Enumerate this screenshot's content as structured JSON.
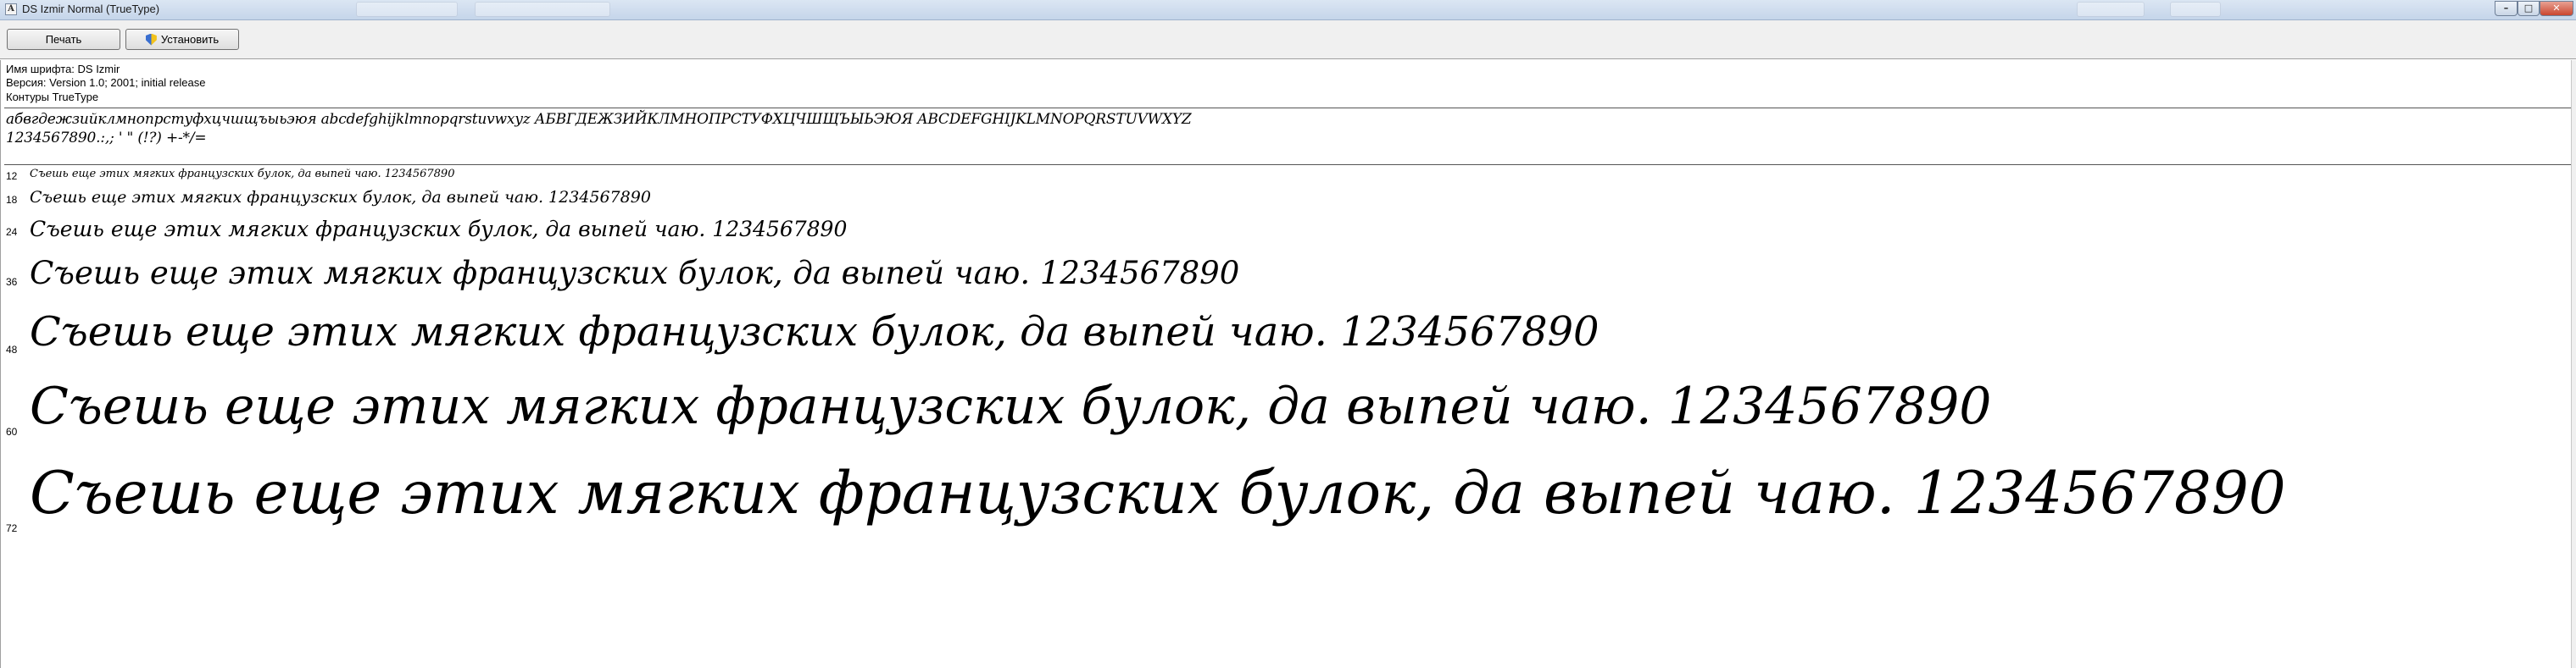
{
  "window": {
    "title": "DS Izmir Normal (TrueType)",
    "controls": {
      "minimize": "–",
      "maximize": "□",
      "close": "✕"
    }
  },
  "toolbar": {
    "print_label": "Печать",
    "install_label": "Установить"
  },
  "info": {
    "font_name": "Имя шрифта: DS Izmir",
    "version": "Версия: Version 1.0; 2001; initial release",
    "outlines": "Контуры TrueType"
  },
  "charset": {
    "letters": "абвгдежзийклмнопрстуфхцчшщъыьэюя abcdefghijklmnopqrstuvwxyz АБВГДЕЖЗИЙКЛМНОПРСТУФХЦЧШЩЪЫЬЭЮЯ ABCDEFGHIJKLMNOPQRSTUVWXYZ",
    "digits": "1234567890.:,; ' \" (!?) +-*/="
  },
  "samples": [
    {
      "size": "12",
      "text": "Съешь еще этих мягких французских булок, да выпей чаю. 1234567890"
    },
    {
      "size": "18",
      "text": "Съешь еще этих мягких французских булок, да выпей чаю. 1234567890"
    },
    {
      "size": "24",
      "text": "Съешь еще этих мягких французских булок, да выпей чаю. 1234567890"
    },
    {
      "size": "36",
      "text": "Съешь еще этих мягких французских булок, да выпей чаю. 1234567890"
    },
    {
      "size": "48",
      "text": "Съешь еще этих мягких французских булок, да выпей чаю. 1234567890"
    },
    {
      "size": "60",
      "text": "Съешь еще этих мягких французских булок, да выпей чаю. 1234567890"
    },
    {
      "size": "72",
      "text": "Съешь еще этих мягких французских булок, да выпей чаю. 1234567890"
    }
  ]
}
